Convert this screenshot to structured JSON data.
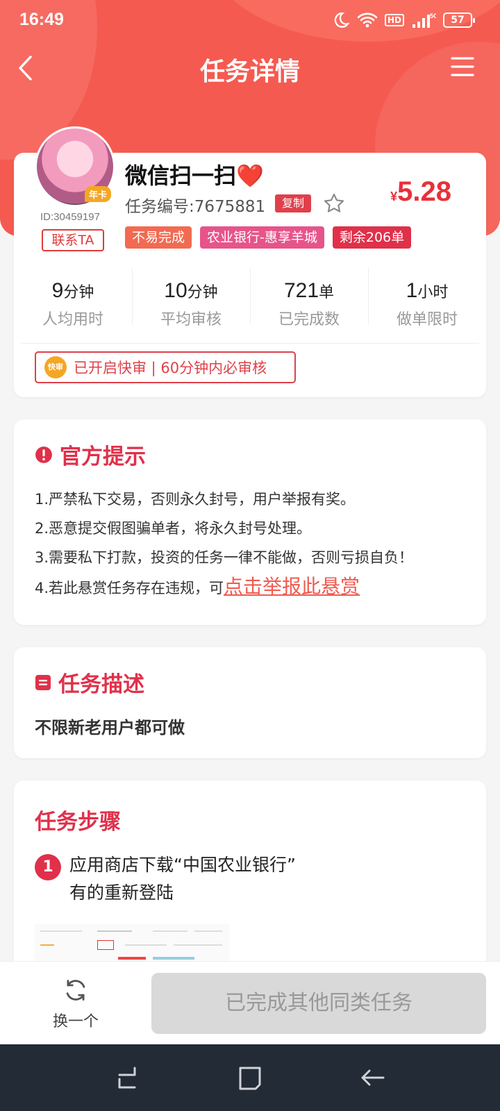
{
  "status": {
    "time": "16:49",
    "network": "5G",
    "hd": "HD",
    "battery": "57"
  },
  "header": {
    "title": "任务详情"
  },
  "task": {
    "avatar_badge": "年卡",
    "user_id": "ID:30459197",
    "contact_label": "联系TA",
    "name": "微信扫一扫❤️",
    "number": "任务编号:7675881",
    "copy_label": "复制",
    "price_symbol": "¥",
    "price": "5.28",
    "tags": [
      "不易完成",
      "农业银行-惠享羊城",
      "剩余206单"
    ],
    "stats": [
      {
        "value": "9",
        "unit": "分钟",
        "label": "人均用时"
      },
      {
        "value": "10",
        "unit": "分钟",
        "label": "平均审核"
      },
      {
        "value": "721",
        "unit": "单",
        "label": "已完成数"
      },
      {
        "value": "1",
        "unit": "小时",
        "label": "做单限时"
      }
    ],
    "fast_icon": "快审",
    "fast_review": "已开启快审 | 60分钟内必审核"
  },
  "tips": {
    "title": "官方提示",
    "items": [
      "1.严禁私下交易，否则永久封号，用户举报有奖。",
      "2.恶意提交假图骗单者，将永久封号处理。",
      "3.需要私下打款，投资的任务一律不能做，否则亏损自负！"
    ],
    "item4_prefix": "4.若此悬赏任务存在违规，可",
    "report_link": "点击举报此悬赏"
  },
  "description": {
    "title": "任务描述",
    "text": "不限新老用户都可做"
  },
  "steps": {
    "title": "任务步骤",
    "items": [
      {
        "num": "1",
        "text_line1": "应用商店下载“中国农业银行”",
        "text_line2": "有的重新登陆"
      }
    ]
  },
  "bottom": {
    "switch_label": "换一个",
    "done_label": "已完成其他同类任务"
  },
  "colors": {
    "brand": "#f55a50",
    "accent": "#e0304a",
    "price": "#e8303a"
  }
}
